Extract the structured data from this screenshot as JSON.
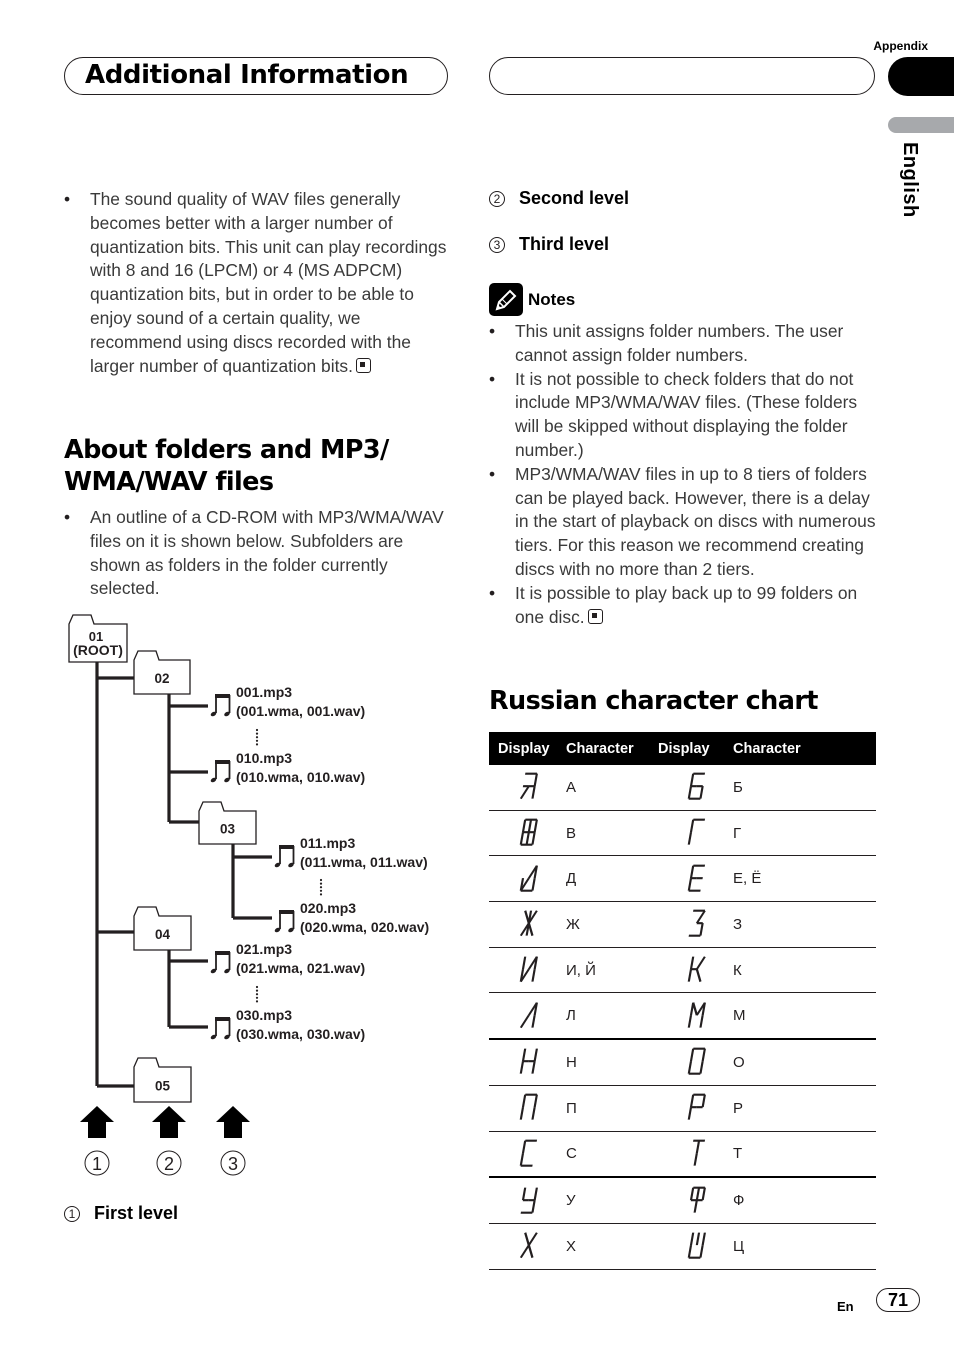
{
  "header": {
    "section_title": "Additional Information",
    "appendix_label": "Appendix",
    "language_tab": "English"
  },
  "left": {
    "wav_bullet": "The sound quality of WAV files generally becomes better with a larger number of quantization bits. This unit can play recordings with 8 and 16 (LPCM) or 4 (MS ADPCM) quantization bits, but in order to be able to enjoy sound of a certain quality, we recommend using discs recorded with the larger number of quantization bits.",
    "folders_heading_line1": "About folders and MP3/",
    "folders_heading_line2": "WMA/WAV files",
    "folders_bullet": "An outline of a CD-ROM with MP3/WMA/WAV files on it is shown below. Subfolders are shown as folders in the folder currently selected."
  },
  "diagram": {
    "folders": [
      {
        "label": "01",
        "sublabel": "(ROOT)"
      },
      {
        "label": "02"
      },
      {
        "label": "03"
      },
      {
        "label": "04"
      },
      {
        "label": "05"
      }
    ],
    "files": [
      {
        "name": "001.mp3",
        "alt": "(001.wma, 001.wav)"
      },
      {
        "name": "010.mp3",
        "alt": "(010.wma, 010.wav)"
      },
      {
        "name": "011.mp3",
        "alt": "(011.wma, 011.wav)"
      },
      {
        "name": "020.mp3",
        "alt": "(020.wma, 020.wav)"
      },
      {
        "name": "021.mp3",
        "alt": "(021.wma, 021.wav)"
      },
      {
        "name": "030.mp3",
        "alt": "(030.wma, 030.wav)"
      }
    ],
    "level_markers": [
      "1",
      "2",
      "3"
    ],
    "icons": {
      "folder": "folder-icon",
      "file": "music-note-icon",
      "arrow": "arrow-up-icon"
    }
  },
  "levels": [
    {
      "num": "1",
      "label": "First level"
    },
    {
      "num": "2",
      "label": "Second level"
    },
    {
      "num": "3",
      "label": "Third level"
    }
  ],
  "notes": {
    "title": "Notes",
    "icon": "pencil-icon",
    "items": [
      "This unit assigns folder numbers. The user cannot assign folder numbers.",
      "It is not possible to check folders that do not include MP3/WMA/WAV files. (These folders will be skipped without displaying the folder number.)",
      "MP3/WMA/WAV files in up to 8 tiers of folders can be played back. However, there is a delay in the start of playback on discs with numerous tiers. For this reason we recommend creating discs with no more than 2 tiers.",
      "It is possible to play back up to 99 folders on one disc."
    ]
  },
  "russian_chart": {
    "title": "Russian character chart",
    "headers": [
      "Display",
      "Character",
      "Display",
      "Character"
    ],
    "rows": [
      {
        "left": {
          "glyph": "А",
          "char": "А"
        },
        "right": {
          "glyph": "Б",
          "char": "Б"
        }
      },
      {
        "left": {
          "glyph": "В",
          "char": "В"
        },
        "right": {
          "glyph": "Г",
          "char": "Г"
        }
      },
      {
        "left": {
          "glyph": "Д",
          "char": "Д"
        },
        "right": {
          "glyph": "Е",
          "char": "Е, Ё"
        }
      },
      {
        "left": {
          "glyph": "Ж",
          "char": "Ж"
        },
        "right": {
          "glyph": "З",
          "char": "З"
        }
      },
      {
        "left": {
          "glyph": "И",
          "char": "И, Й"
        },
        "right": {
          "glyph": "К",
          "char": "К"
        }
      },
      {
        "left": {
          "glyph": "Л",
          "char": "Л"
        },
        "right": {
          "glyph": "М",
          "char": "М"
        }
      },
      {
        "left": {
          "glyph": "Н",
          "char": "Н"
        },
        "right": {
          "glyph": "О",
          "char": "О"
        }
      },
      {
        "left": {
          "glyph": "П",
          "char": "П"
        },
        "right": {
          "glyph": "Р",
          "char": "Р"
        }
      },
      {
        "left": {
          "glyph": "С",
          "char": "С"
        },
        "right": {
          "glyph": "Т",
          "char": "Т"
        }
      },
      {
        "left": {
          "glyph": "У",
          "char": "У"
        },
        "right": {
          "glyph": "Ф",
          "char": "Ф"
        }
      },
      {
        "left": {
          "glyph": "Х",
          "char": "Х"
        },
        "right": {
          "glyph": "Ц",
          "char": "Ц"
        }
      }
    ]
  },
  "footer": {
    "lang": "En",
    "page": "71"
  }
}
